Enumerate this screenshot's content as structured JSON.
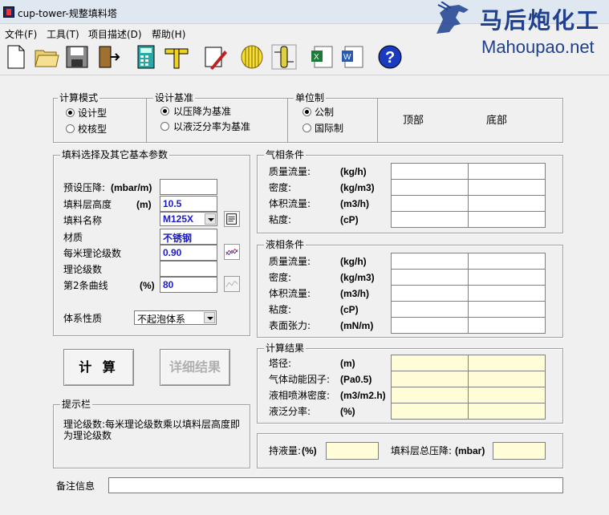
{
  "window": {
    "title": "cup-tower-规整填料塔"
  },
  "watermark": {
    "cn": "马后炮化工",
    "en": "Mahoupao.net"
  },
  "menu": [
    "文件(F)",
    "工具(T)",
    "项目描述(D)",
    "帮助(H)"
  ],
  "toolbar": [
    "new-file-icon",
    "open-folder-icon",
    "save-disk-icon",
    "exit-door-icon",
    "calculator-icon",
    "ruler-icon",
    "document-pen-icon",
    "packing-icon",
    "tower-icon",
    "excel-icon",
    "word-icon",
    "help-icon"
  ],
  "calc_mode": {
    "label": "计算模式",
    "options": [
      "设计型",
      "校核型"
    ],
    "selected": 0
  },
  "design_basis": {
    "label": "设计基准",
    "options": [
      "以压降为基准",
      "以液泛分率为基准"
    ],
    "selected": 0
  },
  "units": {
    "label": "单位制",
    "options": [
      "公制",
      "国际制"
    ],
    "selected": 0
  },
  "columns": {
    "top": "顶部",
    "bottom": "底部"
  },
  "packing": {
    "label": "填料选择及其它基本参数",
    "rows": [
      {
        "label": "预设压降:",
        "unit": "(mbar/m)",
        "value": ""
      },
      {
        "label": "填料层高度",
        "unit": "(m)",
        "value": "10.5"
      },
      {
        "label": "填料名称",
        "unit": "",
        "value": "M125X"
      },
      {
        "label": "材质",
        "unit": "",
        "value": "不锈钢"
      },
      {
        "label": "每米理论级数",
        "unit": "",
        "value": "0.90"
      },
      {
        "label": "理论级数",
        "unit": "",
        "value": ""
      },
      {
        "label": "第2条曲线",
        "unit": "(%)",
        "value": "80"
      }
    ],
    "system_label": "体系性质",
    "system_value": "不起泡体系"
  },
  "gas": {
    "label": "气相条件",
    "rows": [
      {
        "label": "质量流量:",
        "unit": "(kg/h)"
      },
      {
        "label": "密度:",
        "unit": "(kg/m3)"
      },
      {
        "label": "体积流量:",
        "unit": "(m3/h)"
      },
      {
        "label": "粘度:",
        "unit": "(cP)"
      }
    ]
  },
  "liquid": {
    "label": "液相条件",
    "rows": [
      {
        "label": "质量流量:",
        "unit": "(kg/h)"
      },
      {
        "label": "密度:",
        "unit": "(kg/m3)"
      },
      {
        "label": "体积流量:",
        "unit": "(m3/h)"
      },
      {
        "label": "粘度:",
        "unit": "(cP)"
      },
      {
        "label": "表面张力:",
        "unit": "(mN/m)"
      }
    ]
  },
  "results": {
    "label": "计算结果",
    "rows": [
      {
        "label": "塔径:",
        "unit": "(m)"
      },
      {
        "label": "气体动能因子:",
        "unit": "(Pa0.5)"
      },
      {
        "label": "液相喷淋密度:",
        "unit": "(m3/m2.h)"
      },
      {
        "label": "液泛分率:",
        "unit": "(%)"
      }
    ],
    "holdup_label": "持液量:",
    "holdup_unit": "(%)",
    "total_dp_label": "填料层总压降:",
    "total_dp_unit": "(mbar)"
  },
  "buttons": {
    "calc": "计 算",
    "details": "详细结果"
  },
  "hint": {
    "label": "提示栏",
    "text": "理论级数:每米理论级数乘以填料层高度即为理论级数"
  },
  "remarks": {
    "label": "备注信息",
    "value": ""
  }
}
